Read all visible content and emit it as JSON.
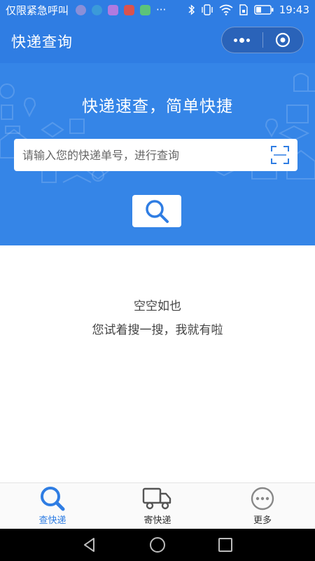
{
  "status_bar": {
    "carrier": "仅限紧急呼叫",
    "more": "···",
    "time": "19:43",
    "notification_icons": [
      "shield-app-icon",
      "browser-app-icon",
      "gallery-app-icon",
      "security-app-icon",
      "game-app-icon"
    ],
    "notification_colors": [
      "#8a8fd8",
      "#3b9ad9",
      "#b07ae0",
      "#d9534f",
      "#5bc47a"
    ]
  },
  "header": {
    "title": "快递查询"
  },
  "hero": {
    "slogan": "快递速查，简单快捷",
    "search_placeholder": "请输入您的快递单号，进行查询",
    "search_value": ""
  },
  "empty_state": {
    "title": "空空如也",
    "subtitle": "您试着搜一搜，我就有啦"
  },
  "tab_bar": {
    "tabs": [
      {
        "label": "查快递",
        "icon": "search-icon",
        "active": true
      },
      {
        "label": "寄快递",
        "icon": "truck-icon",
        "active": false
      },
      {
        "label": "更多",
        "icon": "more-icon",
        "active": false
      }
    ]
  },
  "colors": {
    "brand": "#2f7de3",
    "hero": "#3585e7",
    "active_tab": "#2f7de3"
  }
}
